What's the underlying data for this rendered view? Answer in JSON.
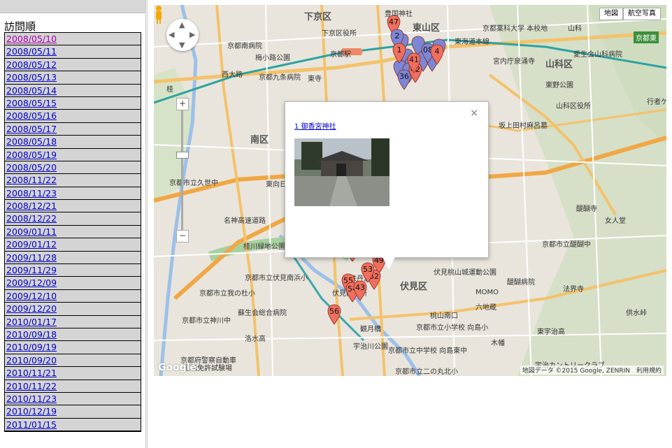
{
  "sidebar": {
    "title": "訪問順",
    "dates": [
      "2008/05/10",
      "2008/05/11",
      "2008/05/12",
      "2008/05/13",
      "2008/05/14",
      "2008/05/15",
      "2008/05/16",
      "2008/05/17",
      "2008/05/18",
      "2008/05/19",
      "2008/05/20",
      "2008/11/22",
      "2008/11/23",
      "2008/12/21",
      "2008/12/22",
      "2009/01/11",
      "2009/01/12",
      "2009/11/28",
      "2009/11/29",
      "2009/12/09",
      "2009/12/10",
      "2009/12/20",
      "2010/01/17",
      "2010/09/18",
      "2010/09/19",
      "2010/09/20",
      "2010/11/21",
      "2010/11/22",
      "2010/11/23",
      "2010/12/19",
      "2011/01/15"
    ]
  },
  "map": {
    "type_buttons": [
      "地図",
      "航空写真"
    ],
    "badge": "京都東",
    "footer": "地図データ ©2015 Google, ZENRIN　利用規約",
    "google_logo": "Google",
    "labels": [
      {
        "t": "下京区",
        "big": true
      },
      {
        "t": "東山区",
        "big": true
      },
      {
        "t": "山科区",
        "big": true
      },
      {
        "t": "南区",
        "big": true
      },
      {
        "t": "伏見区",
        "big": true
      },
      {
        "t": "京都駅",
        "big": false
      },
      {
        "t": "東海道本線",
        "big": false
      },
      {
        "t": "名神高速道路",
        "big": false
      },
      {
        "t": "京都市立久世中",
        "big": false
      },
      {
        "t": "京都市立我の杜小",
        "big": false
      },
      {
        "t": "醍醐寺",
        "big": false
      },
      {
        "t": "女人堂",
        "big": false
      },
      {
        "t": "京都市立醍醐中",
        "big": false
      },
      {
        "t": "伏見桃山城運動公園",
        "big": false
      },
      {
        "t": "桃山南口",
        "big": false
      },
      {
        "t": "六地蔵",
        "big": false
      },
      {
        "t": "観月橋",
        "big": false
      },
      {
        "t": "宇治川公園",
        "big": false
      },
      {
        "t": "東寺",
        "big": false
      },
      {
        "t": "京都九条病院",
        "big": false
      },
      {
        "t": "京都南病院",
        "big": false
      },
      {
        "t": "梅小路公園",
        "big": false
      },
      {
        "t": "豊国神社",
        "big": false
      },
      {
        "t": "京都薬科大学 本校地",
        "big": false
      },
      {
        "t": "宮内庁泉涌寺",
        "big": false
      },
      {
        "t": "愛生会山科病院",
        "big": false
      },
      {
        "t": "東野公園",
        "big": false
      },
      {
        "t": "山科区役所",
        "big": false
      },
      {
        "t": "坂上田村麻呂墓",
        "big": false
      },
      {
        "t": "伏見区役所",
        "big": false
      },
      {
        "t": "蘇生会総合病院",
        "big": false
      },
      {
        "t": "京都市立神川中",
        "big": false
      },
      {
        "t": "洛水高",
        "big": false
      },
      {
        "t": "京都府警察自動車",
        "big": false
      },
      {
        "t": "運転免許試験場",
        "big": false
      },
      {
        "t": "京都市立中学校 向島東中",
        "big": false
      },
      {
        "t": "京都市立二の丸北小",
        "big": false
      },
      {
        "t": "宇治カントリークラブ",
        "big": false
      },
      {
        "t": "MOMO",
        "big": false
      },
      {
        "t": "法界寺",
        "big": false
      },
      {
        "t": "供水峠",
        "big": false
      },
      {
        "t": "東宇治高",
        "big": false
      },
      {
        "t": "木幡",
        "big": false
      },
      {
        "t": "醍醐病院",
        "big": false
      },
      {
        "t": "京都市立小学校 向島小",
        "big": false
      },
      {
        "t": "近鉄丹波橋",
        "big": false
      },
      {
        "t": "京都市立伏見南浜小",
        "big": false
      },
      {
        "t": "東向日",
        "big": false
      },
      {
        "t": "桂川緑地公園 橋梁話公園",
        "big": false
      },
      {
        "t": "西大路",
        "big": false
      },
      {
        "t": "桂",
        "big": false
      },
      {
        "t": "山科",
        "big": false
      },
      {
        "t": "京都東",
        "big": false
      },
      {
        "t": "行者ケ",
        "big": false
      },
      {
        "t": "下京区役所",
        "big": false
      }
    ],
    "markers": [
      {
        "n": "47",
        "c": "red"
      },
      {
        "n": "57",
        "c": "red"
      },
      {
        "n": "49",
        "c": "red"
      },
      {
        "n": "55",
        "c": "red"
      },
      {
        "n": "54",
        "c": "red"
      },
      {
        "n": "43",
        "c": "red"
      },
      {
        "n": "52",
        "c": "red"
      },
      {
        "n": "53",
        "c": "red"
      },
      {
        "n": "56",
        "c": "red"
      },
      {
        "n": "42",
        "c": "red"
      },
      {
        "n": "41",
        "c": "red"
      },
      {
        "n": "36",
        "c": "blue"
      },
      {
        "n": "08",
        "c": "blue"
      },
      {
        "n": "4",
        "c": "red"
      },
      {
        "n": "2",
        "c": "blue"
      },
      {
        "n": "1",
        "c": "red"
      }
    ]
  },
  "popup": {
    "link_text": "1 御香宮神社",
    "close": "×"
  }
}
